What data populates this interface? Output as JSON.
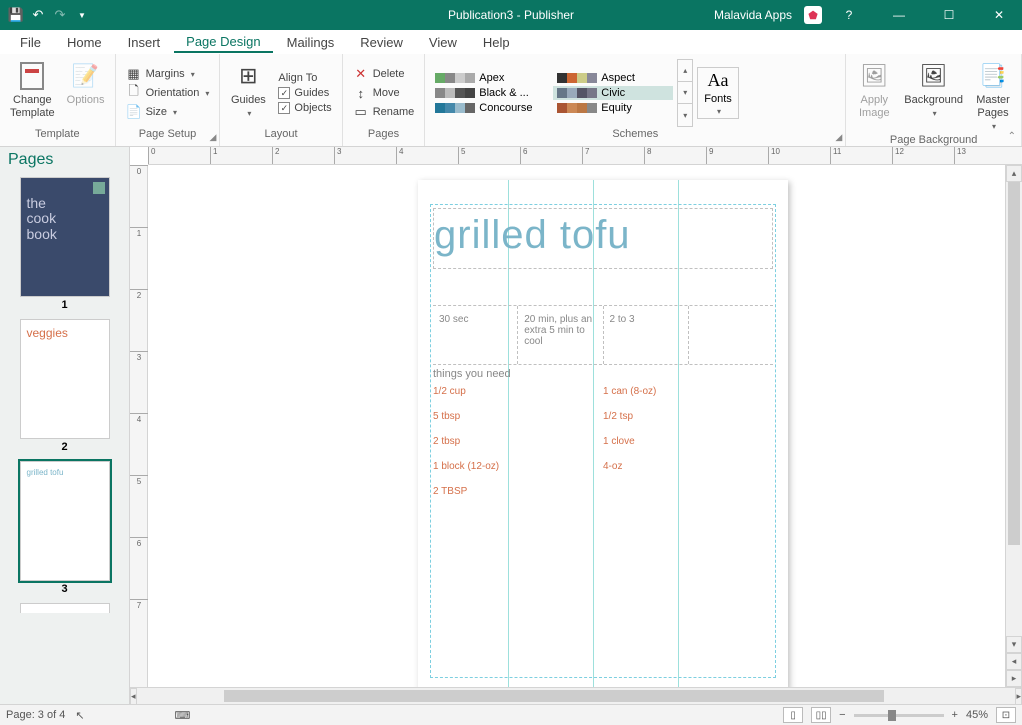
{
  "titlebar": {
    "title": "Publication3 - Publisher",
    "account": "Malavida Apps"
  },
  "menu": {
    "file": "File",
    "home": "Home",
    "insert": "Insert",
    "page_design": "Page Design",
    "mailings": "Mailings",
    "review": "Review",
    "view": "View",
    "help": "Help"
  },
  "ribbon": {
    "template": {
      "change": "Change\nTemplate",
      "options": "Options",
      "label": "Template"
    },
    "page_setup": {
      "margins": "Margins",
      "orientation": "Orientation",
      "size": "Size",
      "label": "Page Setup"
    },
    "layout": {
      "guides": "Guides",
      "align": "Align To",
      "guides_chk": "Guides",
      "objects_chk": "Objects",
      "label": "Layout"
    },
    "pages": {
      "delete": "Delete",
      "move": "Move",
      "rename": "Rename",
      "label": "Pages"
    },
    "schemes": {
      "items": [
        [
          {
            "n": "Apex"
          },
          {
            "n": "Aspect"
          }
        ],
        [
          {
            "n": "Black & ..."
          },
          {
            "n": "Civic",
            "sel": true
          }
        ],
        [
          {
            "n": "Concourse"
          },
          {
            "n": "Equity"
          }
        ]
      ],
      "label": "Schemes",
      "fonts": "Fonts"
    },
    "bg": {
      "apply": "Apply\nImage",
      "background": "Background",
      "master": "Master\nPages",
      "label": "Page Background"
    }
  },
  "pages_panel": {
    "header": "Pages",
    "thumb1_a": "the",
    "thumb1_b": "cook",
    "thumb1_c": "book",
    "thumb2_title": "veggies",
    "thumb3_title": "grilled tofu",
    "n1": "1",
    "n2": "2",
    "n3": "3"
  },
  "doc": {
    "title": "grilled tofu",
    "prep": "30 sec",
    "cook": "20 min, plus an extra 5 min to cool",
    "serves": "2 to 3",
    "things": "things you need",
    "col1": [
      "1/2 cup",
      "5 tbsp",
      "2 tbsp",
      "1 block (12-oz)",
      "2 TBSP"
    ],
    "col2": [
      "1 can (8-oz)",
      "1/2 tsp",
      "1 clove",
      "4-oz"
    ]
  },
  "status": {
    "page": "Page: 3 of 4",
    "zoom": "45%"
  },
  "ruler_h": [
    "0",
    "1",
    "2",
    "3",
    "4",
    "5",
    "6",
    "7",
    "8",
    "9",
    "10",
    "11",
    "12",
    "13"
  ],
  "ruler_v": [
    "0",
    "1",
    "2",
    "3",
    "4",
    "5",
    "6",
    "7"
  ]
}
